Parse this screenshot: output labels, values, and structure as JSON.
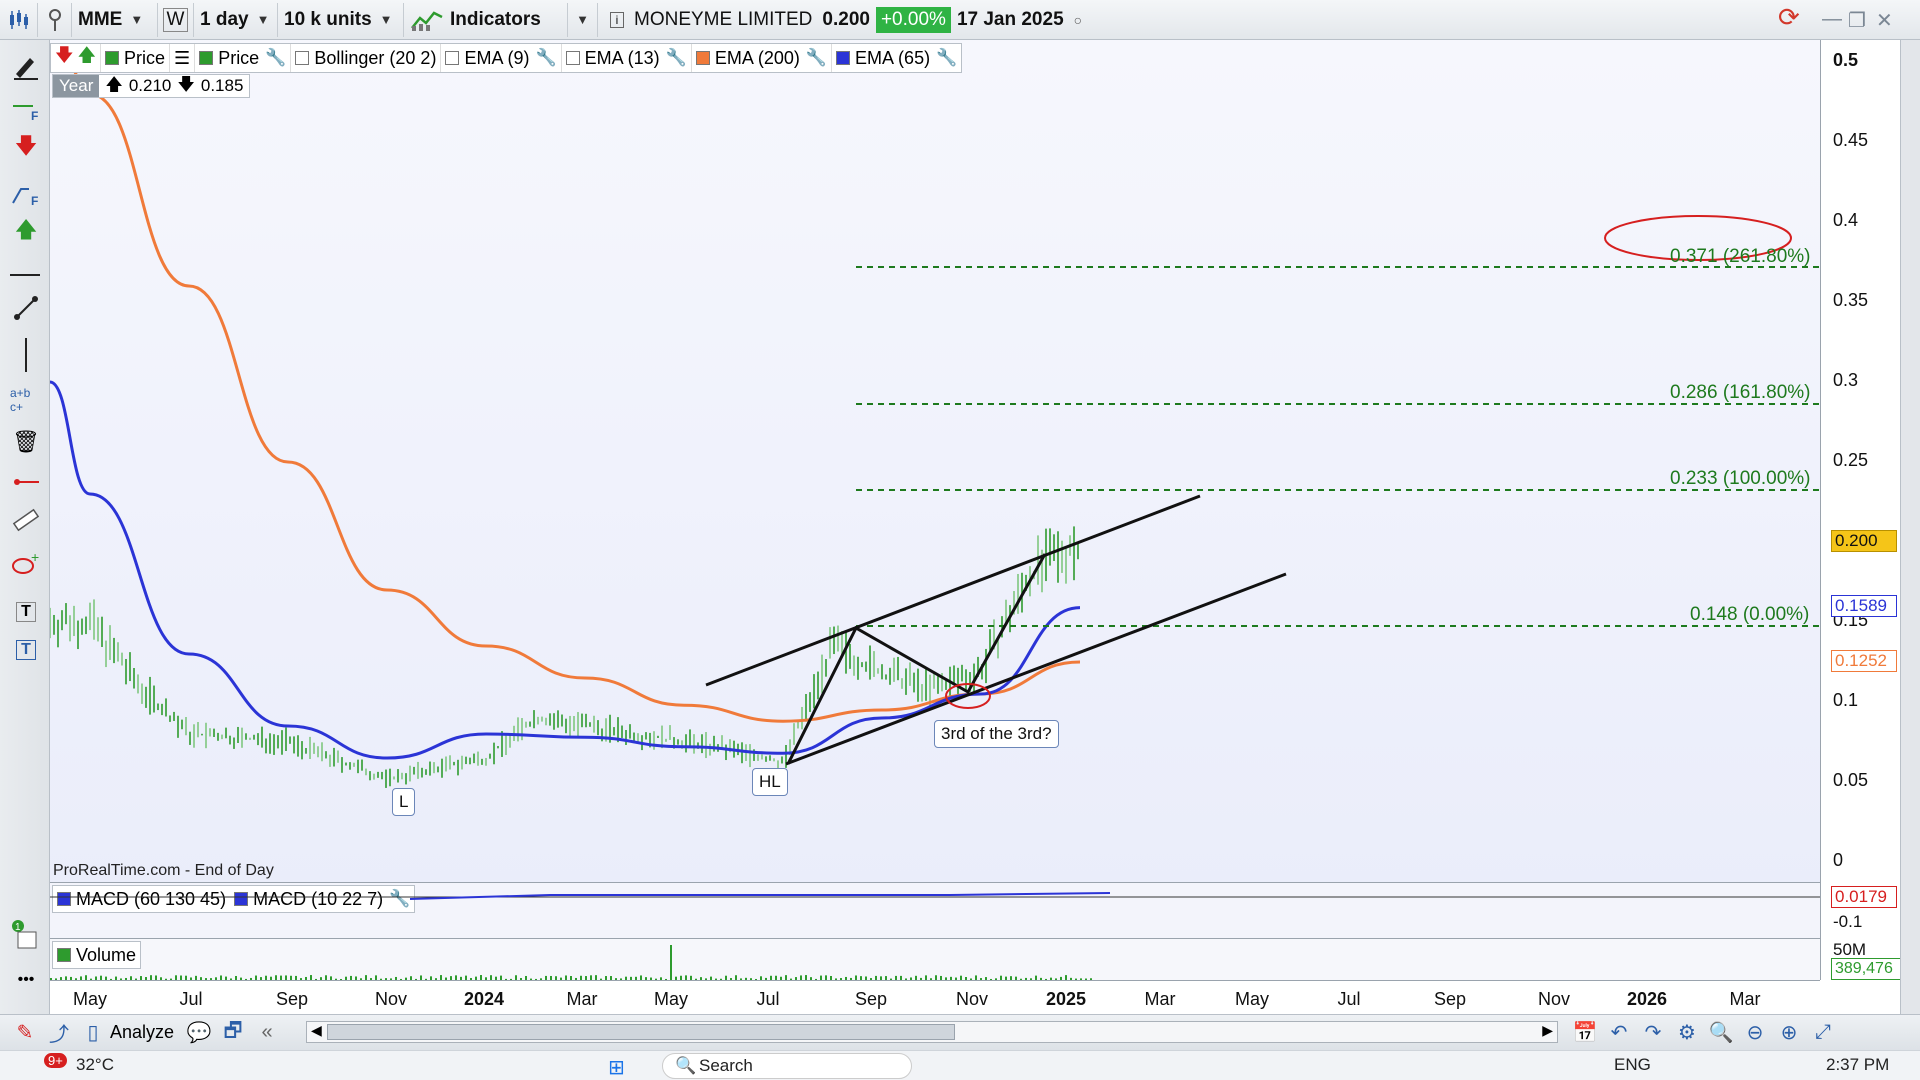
{
  "toolbar": {
    "symbol": "MME",
    "period_w": "W",
    "interval": "1 day",
    "units": "10 k units",
    "indicators_label": "Indicators",
    "instrument_name": "MONEYME LIMITED",
    "last_price": "0.200",
    "change": "+0.00%",
    "date": "17 Jan 2025"
  },
  "legend": {
    "price1": "Price",
    "price2": "Price",
    "bollinger": "Bollinger (20 2)",
    "ema9": "EMA (9)",
    "ema13": "EMA (13)",
    "ema200": "EMA (200)",
    "ema65": "EMA (65)"
  },
  "range": {
    "label": "Year",
    "high": "0.210",
    "low": "0.185"
  },
  "y_axis": {
    "ticks": [
      "0.5",
      "0.45",
      "0.4",
      "0.35",
      "0.3",
      "0.25",
      "0.2",
      "0.15",
      "0.1",
      "0.05",
      "0"
    ],
    "price_label": "0.200",
    "ema65_label": "0.1589",
    "ema200_label": "0.1252",
    "macd_value": "0.0179",
    "macd_tick": "-0.1",
    "vol_tick": "50M",
    "vol_value": "389,476"
  },
  "fibs": [
    {
      "label": "0.371 (261.80%)"
    },
    {
      "label": "0.286 (161.80%)"
    },
    {
      "label": "0.233 (100.00%)"
    },
    {
      "label": "0.148 (0.00%)"
    }
  ],
  "notes": {
    "low": "L",
    "higher_low": "HL",
    "wave": "3rd of the 3rd?"
  },
  "source": "ProRealTime.com - End of Day",
  "macd": {
    "legend1": "MACD (60 130 45)",
    "legend2": "MACD (10 22 7)"
  },
  "volume": {
    "legend": "Volume"
  },
  "x_axis": [
    "May",
    "Jul",
    "Sep",
    "Nov",
    "2024",
    "Mar",
    "May",
    "Jul",
    "Sep",
    "Nov",
    "2025",
    "Mar",
    "May",
    "Jul",
    "Sep",
    "Nov",
    "2026",
    "Mar"
  ],
  "bottombar": {
    "analyze": "Analyze"
  },
  "taskbar": {
    "temp": "32°C",
    "notif": "9+",
    "search": "Search",
    "lang": "ENG",
    "time": "2:37 PM"
  },
  "colors": {
    "ema200": "#f07a3a",
    "ema65": "#2b34d6",
    "fib": "#1e7a1e",
    "candle": "#2e9b2e",
    "ellipse": "#d61f1f"
  },
  "chart_data": {
    "type": "line",
    "title": "MONEYME LIMITED",
    "ylim": [
      0,
      0.5
    ],
    "x_range": [
      "2023-04",
      "2026-03"
    ],
    "series": [
      {
        "name": "EMA (200)",
        "x": [
          "2023-05",
          "2023-07",
          "2023-09",
          "2023-11",
          "2024-01",
          "2024-03",
          "2024-05",
          "2024-07",
          "2024-09",
          "2024-11",
          "2025-01"
        ],
        "values": [
          0.48,
          0.36,
          0.25,
          0.17,
          0.135,
          0.115,
          0.098,
          0.088,
          0.095,
          0.105,
          0.125
        ]
      },
      {
        "name": "EMA (65)",
        "x": [
          "2023-05",
          "2023-07",
          "2023-09",
          "2023-11",
          "2024-01",
          "2024-03",
          "2024-05",
          "2024-07",
          "2024-09",
          "2024-11",
          "2025-01"
        ],
        "values": [
          0.23,
          0.13,
          0.085,
          0.065,
          0.08,
          0.078,
          0.072,
          0.068,
          0.09,
          0.105,
          0.159
        ]
      },
      {
        "name": "Price",
        "x": [
          "2023-05",
          "2023-06",
          "2023-07",
          "2023-09",
          "2023-11",
          "2024-01",
          "2024-02",
          "2024-04",
          "2024-06",
          "2024-07",
          "2024-08",
          "2024-09",
          "2024-10",
          "2024-11",
          "2024-12",
          "2025-01"
        ],
        "values": [
          0.15,
          0.11,
          0.08,
          0.075,
          0.052,
          0.065,
          0.09,
          0.08,
          0.07,
          0.062,
          0.135,
          0.118,
          0.108,
          0.12,
          0.18,
          0.2
        ]
      }
    ]
  }
}
